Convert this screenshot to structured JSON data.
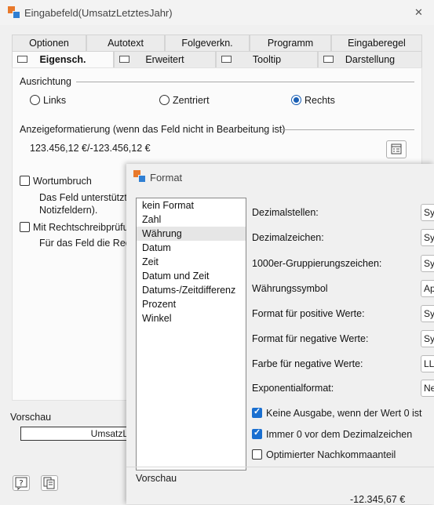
{
  "main_window": {
    "title": "Eingabefeld(UmsatzLetztesJahr)",
    "close_glyph": "✕",
    "tabs_row1": [
      "Optionen",
      "Autotext",
      "Folgeverkn.",
      "Programm",
      "Eingaberegel"
    ],
    "tabs_row2": [
      "Eigensch.",
      "Erweitert",
      "Tooltip",
      "Darstellung"
    ],
    "ausrichtung": {
      "label": "Ausrichtung",
      "options": [
        "Links",
        "Zentriert",
        "Rechts"
      ],
      "selected": "Rechts"
    },
    "anzeige": {
      "label": "Anzeigeformatierung (wenn das Feld nicht in Bearbeitung ist)",
      "value": "123.456,12 €/-123.456,12 €"
    },
    "wortumbruch": {
      "label": "Wortumbruch",
      "checked": false,
      "desc_line1": "Das Feld unterstützt W",
      "desc_line2": "Notizfeldern)."
    },
    "rechtschreib": {
      "label": "Mit Rechtschreibprüfun",
      "checked": false,
      "desc": "Für das Feld die Recht"
    },
    "vorschau": {
      "label": "Vorschau",
      "value": "UmsatzL"
    },
    "bottom_icons": [
      "help-icon",
      "copy-icon"
    ]
  },
  "format_dialog": {
    "title": "Format",
    "list": [
      "kein Format",
      "Zahl",
      "Währung",
      "Datum",
      "Zeit",
      "Datum und Zeit",
      "Datums-/Zeitdifferenz",
      "Prozent",
      "Winkel"
    ],
    "selected": "Währung",
    "fields": [
      {
        "label": "Dezimalstellen:",
        "value": "Sy"
      },
      {
        "label": "Dezimalzeichen:",
        "value": "Sy"
      },
      {
        "label": "1000er-Gruppierungszeichen:",
        "value": "Sy"
      },
      {
        "label": "Währungssymbol",
        "value": "Ap"
      },
      {
        "label": "Format für positive Werte:",
        "value": "Sy"
      },
      {
        "label": "Format für negative Werte:",
        "value": "Sy"
      },
      {
        "label": "Farbe für negative Werte:",
        "value": "LL"
      },
      {
        "label": "Exponentialformat:",
        "value": "Ne"
      }
    ],
    "checkboxes": [
      {
        "label": "Keine Ausgabe, wenn der Wert 0 ist",
        "checked": true
      },
      {
        "label": "Immer 0 vor dem Dezimalzeichen",
        "checked": true
      },
      {
        "label": "Optimierter Nachkommaanteil",
        "checked": false
      }
    ],
    "vorschau_label": "Vorschau",
    "vorschau_value": "-12.345,67 €"
  },
  "colors": {
    "accent": "#1a6fd0",
    "window_bg": "#f0f0f0",
    "panel_bg": "#fbfbfb"
  }
}
